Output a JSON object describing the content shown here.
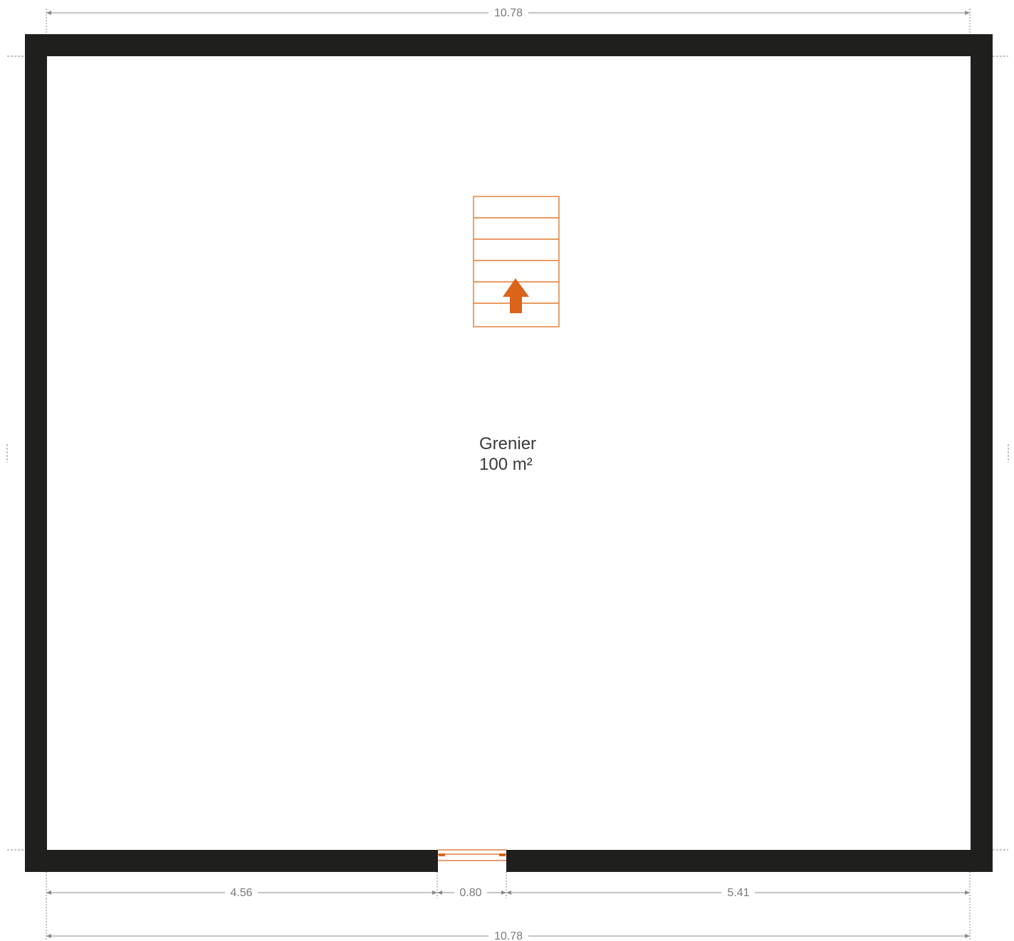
{
  "plan": {
    "room": {
      "name": "Grenier",
      "area": "100 m²"
    },
    "dimensions": {
      "top_total": "10.78",
      "bottom_segment_left": "4.56",
      "bottom_segment_door": "0.80",
      "bottom_segment_right": "5.41",
      "bottom_total": "10.78"
    },
    "colors": {
      "wall": "#1f201e",
      "accent": "#d9641a",
      "dimension_line": "#8a8a8a"
    },
    "icons": {
      "stair_direction": "arrow-up-icon"
    }
  }
}
